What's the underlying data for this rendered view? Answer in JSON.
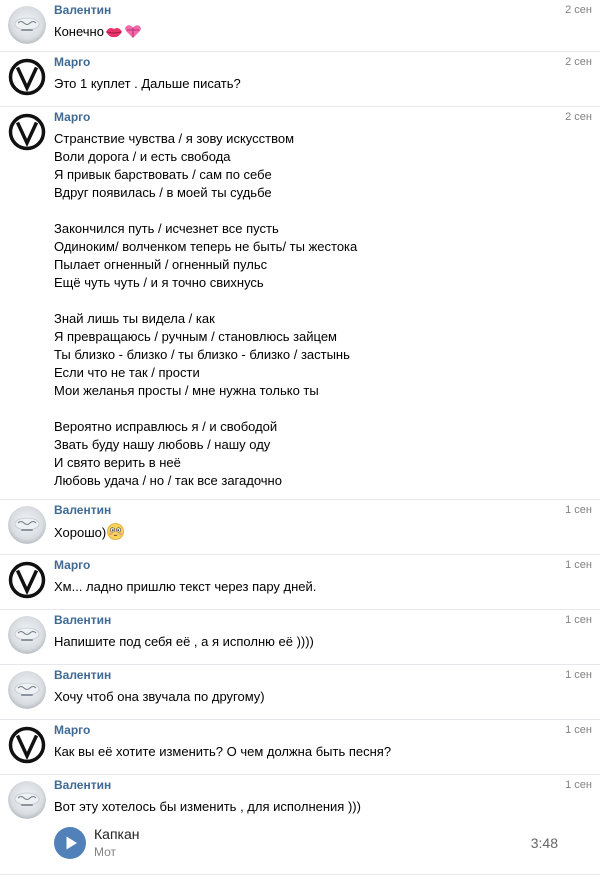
{
  "conversation": {
    "messages": [
      {
        "author": "Валентин",
        "avatar": "valentin-avatar",
        "date": "2 сен",
        "lines": [
          "Конечно"
        ],
        "emoji": [
          "kiss-lips-icon",
          "heart-gift-icon"
        ]
      },
      {
        "author": "Марго",
        "avatar": "margo-avatar",
        "date": "2 сен",
        "lines": [
          "Это 1 куплет . Дальше писать?"
        ]
      },
      {
        "author": "Марго",
        "avatar": "margo-avatar",
        "date": "2 сен",
        "lines": [
          "Странствие чувства / я зову искусством",
          "Воли дорога / и есть свобода",
          "Я привык барствовать / сам по себе",
          "Вдруг появилась / в моей ты судьбе",
          "",
          "Закончился путь / исчезнет все пусть",
          "Одиноким/ волченком теперь не быть/ ты жестока",
          "Пылает огненный / огненный пульс",
          "Ещё чуть чуть / и я точно свихнусь",
          "",
          "Знай лишь ты видела / как",
          "Я превращаюсь / ручным / становлюсь зайцем",
          "Ты близко - близко / ты близко - близко / застынь",
          "Если что не так / прости",
          "Мои желанья просты / мне нужна только ты",
          "",
          "Вероятно исправлюсь я / и свободой",
          "Звать буду нашу любовь / нашу оду",
          "И свято верить в неё",
          "Любовь удача / но / так все загадочно"
        ]
      },
      {
        "author": "Валентин",
        "avatar": "valentin-avatar",
        "date": "1 сен",
        "lines": [
          "Хорошо)"
        ],
        "emoji": [
          "blushing-face-icon"
        ]
      },
      {
        "author": "Марго",
        "avatar": "margo-avatar",
        "date": "1 сен",
        "lines": [
          "Хм... ладно пришлю текст через пару дней."
        ]
      },
      {
        "author": "Валентин",
        "avatar": "valentin-avatar",
        "date": "1 сен",
        "lines": [
          "Напишите под себя её , а я исполню её ))))"
        ]
      },
      {
        "author": "Валентин",
        "avatar": "valentin-avatar",
        "date": "1 сен",
        "lines": [
          "Хочу чтоб она звучала по другому)"
        ]
      },
      {
        "author": "Марго",
        "avatar": "margo-avatar",
        "date": "1 сен",
        "lines": [
          "Как вы её хотите изменить? О чем должна быть песня?"
        ]
      },
      {
        "author": "Валентин",
        "avatar": "valentin-avatar",
        "date": "1 сен",
        "lines": [
          "Вот эту хотелось бы изменить , для исполнения )))"
        ],
        "audio": {
          "title": "Капкан",
          "artist": "Мот",
          "duration": "3:48"
        }
      }
    ]
  },
  "colors": {
    "author": "#3f6a94",
    "date": "#828282",
    "divider": "#e7e8ec",
    "play_button": "#5181b8"
  }
}
